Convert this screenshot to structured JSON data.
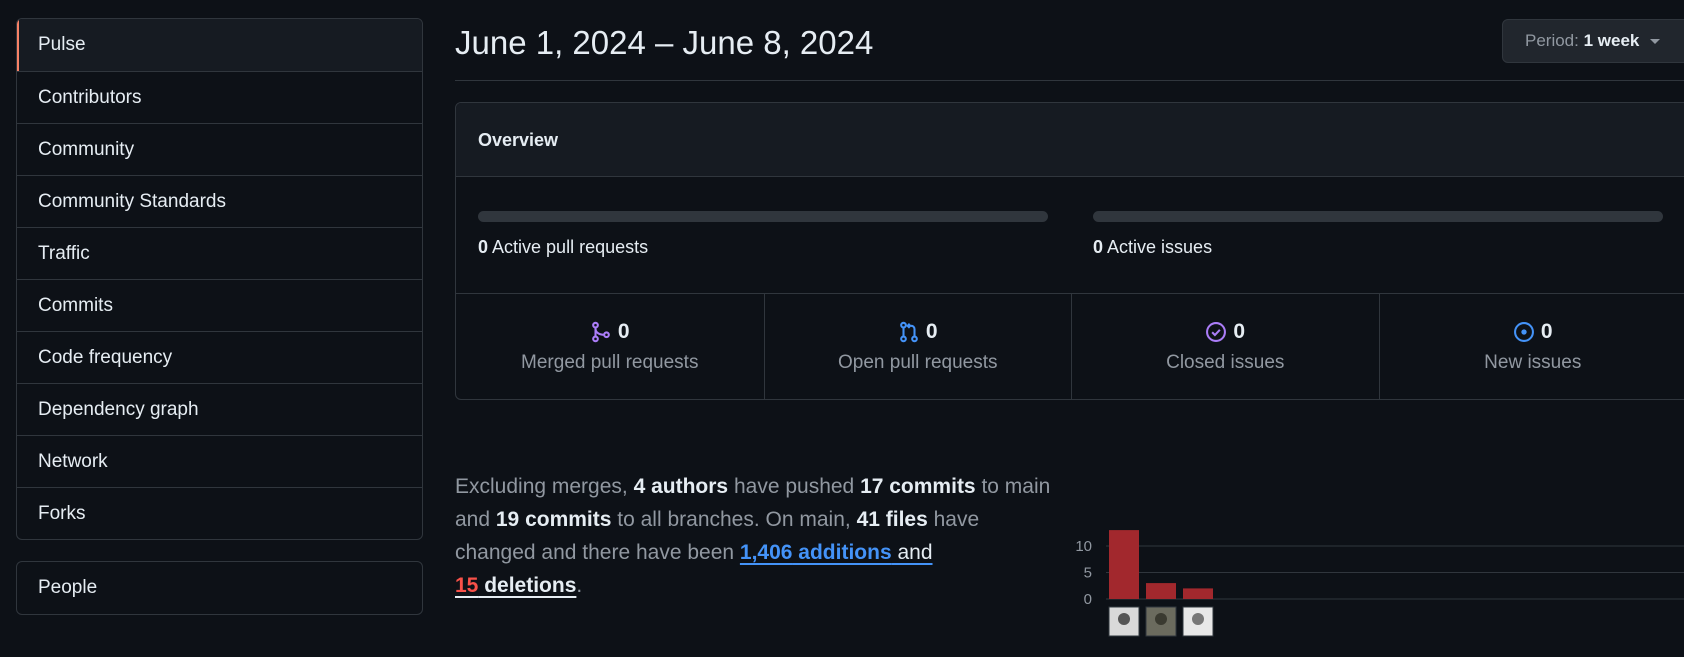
{
  "sidebar": {
    "items": [
      {
        "label": "Pulse",
        "selected": true
      },
      {
        "label": "Contributors"
      },
      {
        "label": "Community"
      },
      {
        "label": "Community Standards"
      },
      {
        "label": "Traffic"
      },
      {
        "label": "Commits"
      },
      {
        "label": "Code frequency"
      },
      {
        "label": "Dependency graph"
      },
      {
        "label": "Network"
      },
      {
        "label": "Forks"
      }
    ],
    "people": {
      "label": "People"
    }
  },
  "header": {
    "title": "June 1, 2024 – June 8, 2024",
    "period_prefix": "Period:",
    "period_value": "1 week"
  },
  "overview": {
    "title": "Overview",
    "active_prs": {
      "count": "0",
      "label": "Active pull requests"
    },
    "active_issues": {
      "count": "0",
      "label": "Active issues"
    },
    "stats": [
      {
        "count": "0",
        "label": "Merged pull requests",
        "icon": "git-merge-icon",
        "color": "#ab7df8"
      },
      {
        "count": "0",
        "label": "Open pull requests",
        "icon": "git-pull-request-icon",
        "color": "#4493f8"
      },
      {
        "count": "0",
        "label": "Closed issues",
        "icon": "issue-closed-icon",
        "color": "#ab7df8"
      },
      {
        "count": "0",
        "label": "New issues",
        "icon": "issue-opened-icon",
        "color": "#4493f8"
      }
    ]
  },
  "summary": {
    "t1": "Excluding merges, ",
    "authors": "4 authors",
    "t2": " have pushed ",
    "commits_main": "17 commits",
    "t3": " to main and ",
    "commits_all": "19 commits",
    "t4": " to all branches. On main, ",
    "files": "41 files",
    "t5": " have changed and there have been ",
    "additions_num": "1,406",
    "additions_word": " additions",
    "t6": " and ",
    "deletions_num": "15",
    "deletions_word": " deletions",
    "t7": "."
  },
  "chart_data": {
    "type": "bar",
    "categories": [
      "author-1",
      "author-2",
      "author-3"
    ],
    "values": [
      13,
      3,
      2
    ],
    "yticks": [
      0,
      5,
      10
    ],
    "ylim": [
      0,
      13
    ],
    "bar_color": "#a2282d",
    "xlabel": "",
    "ylabel": "",
    "title": ""
  },
  "colors": {
    "background": "#0d1117",
    "border": "#30363d",
    "selected_accent": "#f78166",
    "link_blue": "#4493f8",
    "deletion_red": "#f85149"
  }
}
